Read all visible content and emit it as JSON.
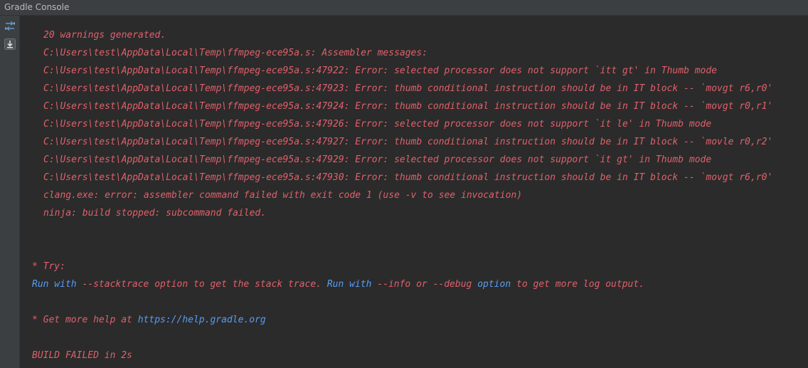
{
  "window": {
    "title": "Gradle Console"
  },
  "toolbar": {
    "icons": [
      "toggle-view-icon",
      "scroll-to-end-icon"
    ]
  },
  "console": {
    "error_lines": [
      "20 warnings generated.",
      "C:\\Users\\test\\AppData\\Local\\Temp\\ffmpeg-ece95a.s: Assembler messages:",
      "C:\\Users\\test\\AppData\\Local\\Temp\\ffmpeg-ece95a.s:47922: Error: selected processor does not support `itt gt' in Thumb mode",
      "C:\\Users\\test\\AppData\\Local\\Temp\\ffmpeg-ece95a.s:47923: Error: thumb conditional instruction should be in IT block -- `movgt r6,r0'",
      "C:\\Users\\test\\AppData\\Local\\Temp\\ffmpeg-ece95a.s:47924: Error: thumb conditional instruction should be in IT block -- `movgt r0,r1'",
      "C:\\Users\\test\\AppData\\Local\\Temp\\ffmpeg-ece95a.s:47926: Error: selected processor does not support `it le' in Thumb mode",
      "C:\\Users\\test\\AppData\\Local\\Temp\\ffmpeg-ece95a.s:47927: Error: thumb conditional instruction should be in IT block -- `movle r0,r2'",
      "C:\\Users\\test\\AppData\\Local\\Temp\\ffmpeg-ece95a.s:47929: Error: selected processor does not support `it gt' in Thumb mode",
      "C:\\Users\\test\\AppData\\Local\\Temp\\ffmpeg-ece95a.s:47930: Error: thumb conditional instruction should be in IT block -- `movgt r6,r0'",
      "clang.exe: error: assembler command failed with exit code 1 (use -v to see invocation)",
      "ninja: build stopped: subcommand failed."
    ],
    "try_header": "* Try:",
    "try_line": {
      "run1": "Run with",
      "opt1": " --stacktrace ",
      "mid1": "option to get the stack trace.",
      "run2": " Run with",
      "opt2": " --info ",
      "or": "or",
      "opt3": " --debug ",
      "opt_word": "option",
      "tail": " to get more log output."
    },
    "help_prefix": "* Get more help at ",
    "help_link": "https://help.gradle.org",
    "build_status": "BUILD FAILED in 2s"
  },
  "colors": {
    "error_text": "#e0606b",
    "link_text": "#589df6",
    "background": "#2b2b2b"
  }
}
